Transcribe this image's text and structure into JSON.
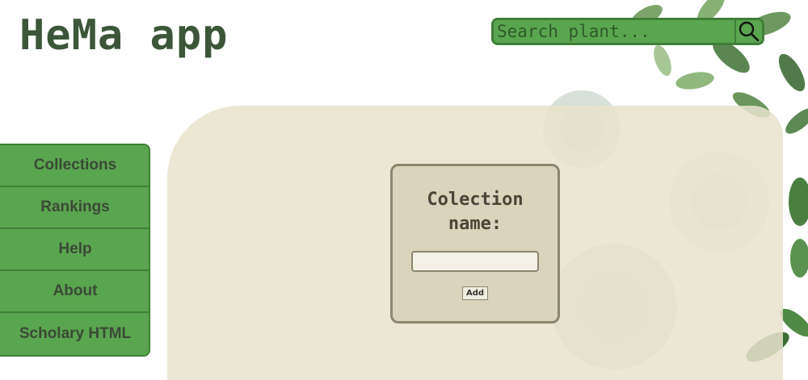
{
  "header": {
    "title": "HeMa app",
    "search": {
      "placeholder": "Search plant...",
      "icon": "search-icon"
    }
  },
  "sidebar": {
    "items": [
      {
        "label": "Collections"
      },
      {
        "label": "Rankings"
      },
      {
        "label": "Help"
      },
      {
        "label": "About"
      },
      {
        "label": "Scholary HTML"
      }
    ]
  },
  "form": {
    "label": "Colection name:",
    "input_value": "",
    "add_label": "Add"
  },
  "colors": {
    "accent_green": "#5aa54f",
    "accent_border": "#3f7f38",
    "title_text": "#3d563a",
    "panel_beige": "#e8e3cd"
  }
}
